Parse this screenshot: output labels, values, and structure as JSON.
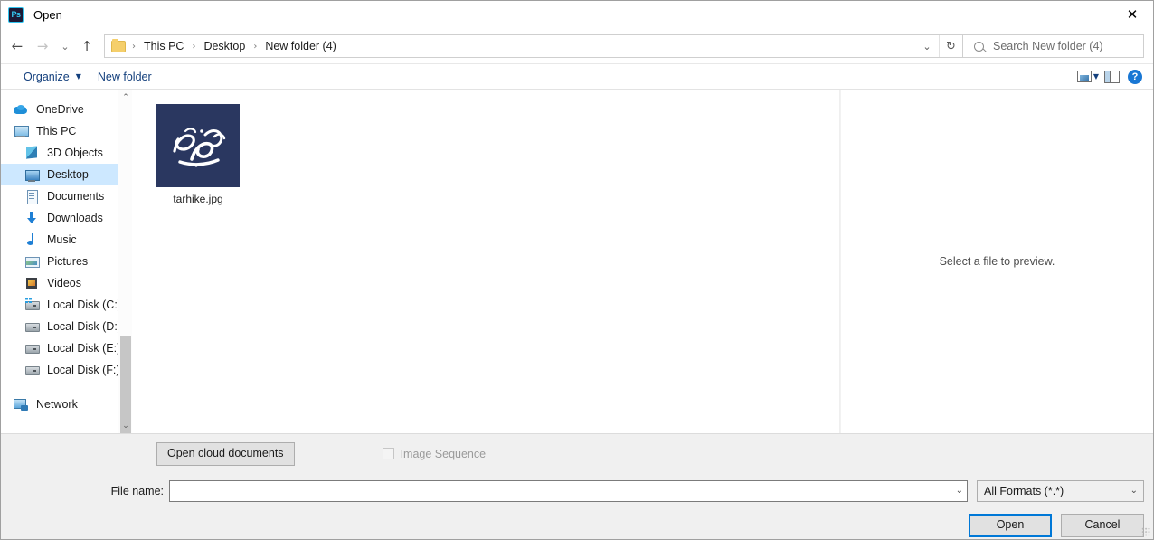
{
  "window": {
    "app_icon": "photoshop-icon",
    "app_icon_text": "Ps",
    "title": "Open",
    "close_label": "✕"
  },
  "address_bar": {
    "back_label": "←",
    "forward_label": "→",
    "recent_label": "⌄",
    "up_label": "↑",
    "breadcrumbs": [
      {
        "label": "This PC"
      },
      {
        "label": "Desktop"
      },
      {
        "label": "New folder (4)"
      }
    ],
    "separator": "›",
    "history_caret": "⌄",
    "refresh_label": "↻",
    "search_placeholder": "Search New folder (4)"
  },
  "command_bar": {
    "organize_label": "Organize",
    "organize_caret": "▼",
    "new_folder_label": "New folder",
    "view_caret": "▼",
    "help_label": "?"
  },
  "sidebar": {
    "items": [
      {
        "label": "OneDrive",
        "icon": "onedrive-icon",
        "indent": 0,
        "selected": false
      },
      {
        "label": "This PC",
        "icon": "this-pc-icon",
        "indent": 0,
        "selected": false
      },
      {
        "label": "3D Objects",
        "icon": "3d-objects-icon",
        "indent": 1,
        "selected": false
      },
      {
        "label": "Desktop",
        "icon": "desktop-icon",
        "indent": 1,
        "selected": true
      },
      {
        "label": "Documents",
        "icon": "documents-icon",
        "indent": 1,
        "selected": false
      },
      {
        "label": "Downloads",
        "icon": "downloads-icon",
        "indent": 1,
        "selected": false
      },
      {
        "label": "Music",
        "icon": "music-icon",
        "indent": 1,
        "selected": false
      },
      {
        "label": "Pictures",
        "icon": "pictures-icon",
        "indent": 1,
        "selected": false
      },
      {
        "label": "Videos",
        "icon": "videos-icon",
        "indent": 1,
        "selected": false
      },
      {
        "label": "Local Disk (C:)",
        "icon": "local-disk-c-icon",
        "indent": 1,
        "selected": false
      },
      {
        "label": "Local Disk (D:)",
        "icon": "local-disk-icon",
        "indent": 1,
        "selected": false
      },
      {
        "label": "Local Disk (E:)",
        "icon": "local-disk-icon",
        "indent": 1,
        "selected": false
      },
      {
        "label": "Local Disk (F:)",
        "icon": "local-disk-icon",
        "indent": 1,
        "selected": false
      },
      {
        "label": "Network",
        "icon": "network-icon",
        "indent": 0,
        "selected": false
      }
    ],
    "scroll_up": "⌃",
    "scroll_down": "⌄"
  },
  "file_list": {
    "files": [
      {
        "name": "tarhike.jpg",
        "thumbnail_color": "#2a3760",
        "thumbnail_type": "calligraphy-image"
      }
    ]
  },
  "preview_pane": {
    "message": "Select a file to preview."
  },
  "footer": {
    "open_cloud_documents_label": "Open cloud documents",
    "image_sequence_label": "Image Sequence",
    "image_sequence_checked": false,
    "file_name_label": "File name:",
    "file_name_value": "",
    "file_name_caret": "⌄",
    "format_value": "All Formats (*.*)",
    "format_caret": "⌄",
    "open_button_label": "Open",
    "cancel_button_label": "Cancel"
  },
  "colors": {
    "accent": "#0078d7",
    "selection": "#cde8ff",
    "link": "#14407d",
    "thumbnail_navy": "#2a3760"
  }
}
